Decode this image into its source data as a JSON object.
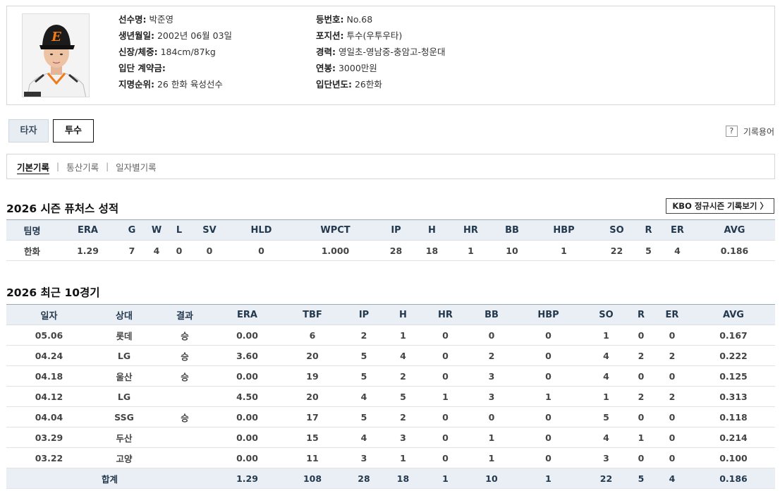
{
  "profile": {
    "left": [
      {
        "k": "선수명:",
        "v": "박준영"
      },
      {
        "k": "생년월일:",
        "v": "2002년 06월 03일"
      },
      {
        "k": "신장/체중:",
        "v": "184cm/87kg"
      },
      {
        "k": "입단 계약금:",
        "v": ""
      },
      {
        "k": "지명순위:",
        "v": "26 한화 육성선수"
      }
    ],
    "right": [
      {
        "k": "등번호:",
        "v": "No.68"
      },
      {
        "k": "포지션:",
        "v": "투수(우투우타)"
      },
      {
        "k": "경력:",
        "v": "영일초-영남중-충암고-청운대"
      },
      {
        "k": "연봉:",
        "v": "3000만원"
      },
      {
        "k": "입단년도:",
        "v": "26한화"
      }
    ]
  },
  "tabs": {
    "batter": "타자",
    "pitcher": "투수"
  },
  "glossary": {
    "icon": "?",
    "label": "기록용어"
  },
  "subnav": [
    "기본기록",
    "통산기록",
    "일자별기록"
  ],
  "season": {
    "title": "2026 시즌 퓨처스 성적",
    "kbo_button": "KBO 정규시즌 기록보기 〉",
    "headers": [
      "팀명",
      "ERA",
      "G",
      "W",
      "L",
      "SV",
      "HLD",
      "WPCT",
      "IP",
      "H",
      "HR",
      "BB",
      "HBP",
      "SO",
      "R",
      "ER",
      "AVG"
    ],
    "rows": [
      [
        "한화",
        "1.29",
        "7",
        "4",
        "0",
        "0",
        "0",
        "1.000",
        "28",
        "18",
        "1",
        "10",
        "1",
        "22",
        "5",
        "4",
        "0.186"
      ]
    ]
  },
  "recent": {
    "title": "2026 최근 10경기",
    "headers": [
      "일자",
      "상대",
      "결과",
      "ERA",
      "TBF",
      "IP",
      "H",
      "HR",
      "BB",
      "HBP",
      "SO",
      "R",
      "ER",
      "AVG"
    ],
    "rows": [
      [
        "05.06",
        "롯데",
        "승",
        "0.00",
        "6",
        "2",
        "1",
        "0",
        "0",
        "0",
        "1",
        "0",
        "0",
        "0.167"
      ],
      [
        "04.24",
        "LG",
        "승",
        "3.60",
        "20",
        "5",
        "4",
        "0",
        "2",
        "0",
        "4",
        "2",
        "2",
        "0.222"
      ],
      [
        "04.18",
        "울산",
        "승",
        "0.00",
        "19",
        "5",
        "2",
        "0",
        "3",
        "0",
        "4",
        "0",
        "0",
        "0.125"
      ],
      [
        "04.12",
        "LG",
        "",
        "4.50",
        "20",
        "4",
        "5",
        "1",
        "3",
        "1",
        "1",
        "2",
        "2",
        "0.313"
      ],
      [
        "04.04",
        "SSG",
        "승",
        "0.00",
        "17",
        "5",
        "2",
        "0",
        "0",
        "0",
        "5",
        "0",
        "0",
        "0.118"
      ],
      [
        "03.29",
        "두산",
        "",
        "0.00",
        "15",
        "4",
        "3",
        "0",
        "1",
        "0",
        "4",
        "1",
        "0",
        "0.214"
      ],
      [
        "03.22",
        "고양",
        "",
        "0.00",
        "11",
        "3",
        "1",
        "0",
        "1",
        "0",
        "3",
        "0",
        "0",
        "0.100"
      ]
    ],
    "total": [
      "합계",
      "1.29",
      "108",
      "28",
      "18",
      "1",
      "10",
      "1",
      "22",
      "5",
      "4",
      "0.186"
    ]
  }
}
